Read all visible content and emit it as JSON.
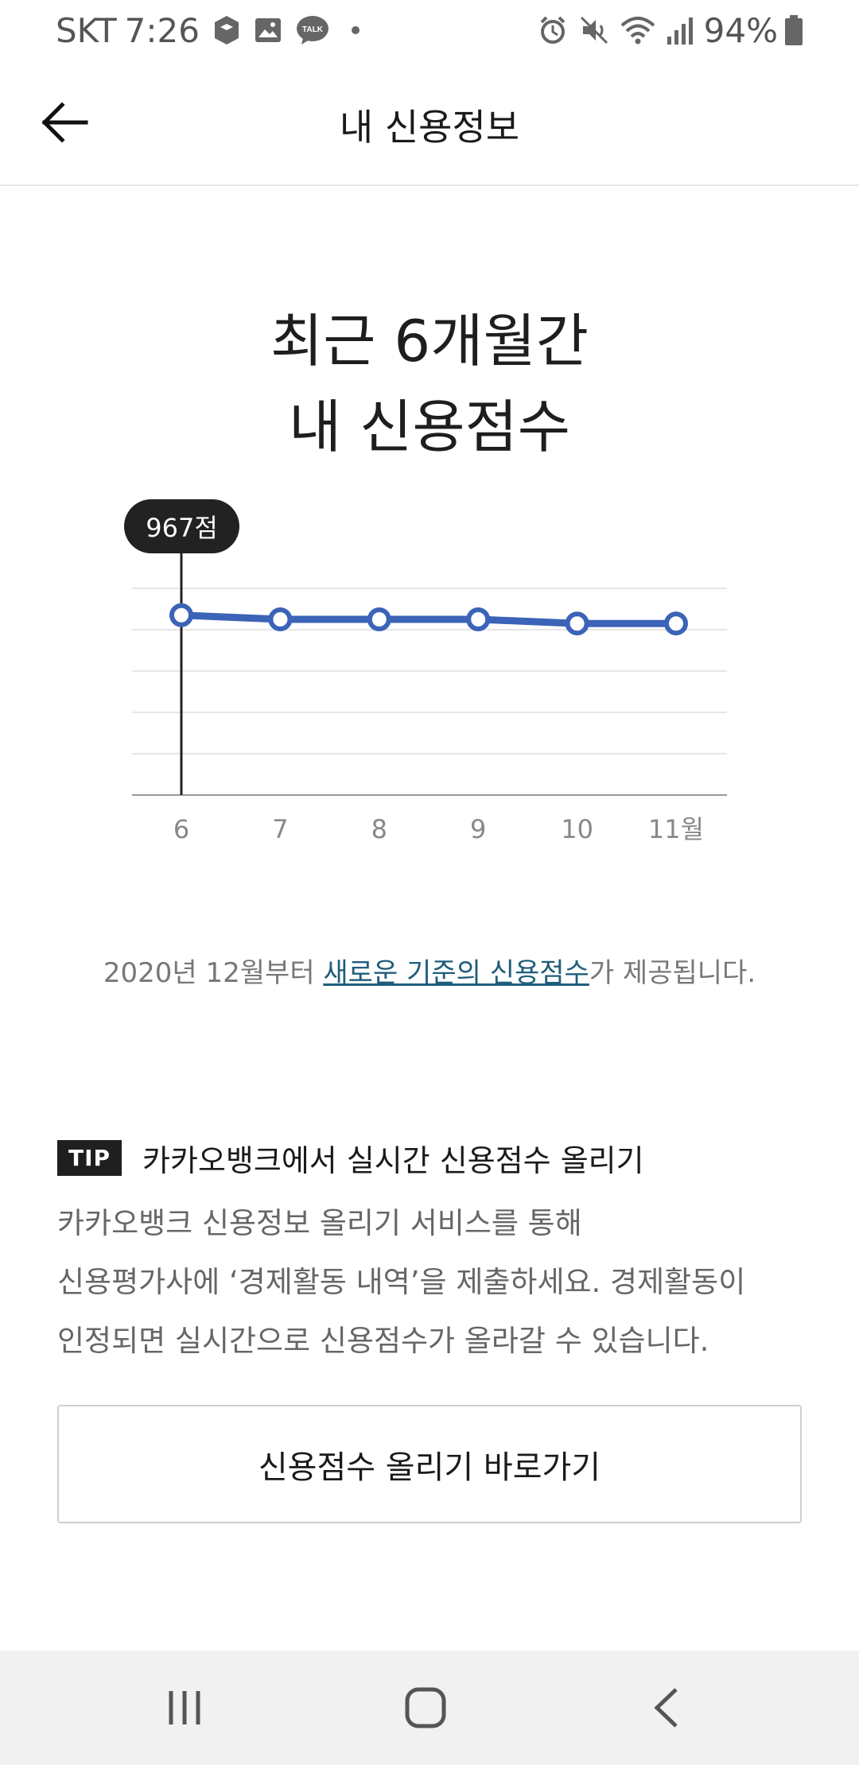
{
  "status_bar": {
    "carrier": "SKT",
    "time": "7:26",
    "battery_percent": "94%",
    "left_icons": [
      "shield-app-icon",
      "gallery-icon",
      "talk-icon",
      "dot-icon"
    ],
    "right_icons": [
      "alarm-icon",
      "mute-icon",
      "wifi-icon",
      "signal-icon",
      "battery-icon"
    ],
    "talk_icon_text": "TALK"
  },
  "app_bar": {
    "title": "내 신용정보",
    "back_icon": "arrow-left-icon"
  },
  "heading": {
    "line1": "최근 6개월간",
    "line2": "내 신용점수"
  },
  "chart_data": {
    "type": "line",
    "categories": [
      "6",
      "7",
      "8",
      "9",
      "10",
      "11월"
    ],
    "values": [
      967,
      965,
      965,
      965,
      963,
      963
    ],
    "ylim": [
      880,
      980
    ],
    "grid": true,
    "line_color": "#3b63b7",
    "selected_index": 0,
    "selected_label": "967점"
  },
  "notice": {
    "prefix": "2020년 12월부터 ",
    "link": "새로운 기준의 신용점수",
    "suffix": "가 제공됩니다."
  },
  "tip": {
    "badge": "TIP",
    "title": "카카오뱅크에서 실시간 신용점수 올리기",
    "lines": [
      "카카오뱅크 신용정보 올리기 서비스를 통해",
      "신용평가사에 ‘경제활동 내역’을 제출하세요. 경제활동이",
      "인정되면 실시간으로 신용점수가 올라갈 수 있습니다."
    ]
  },
  "cta": {
    "label": "신용점수 올리기 바로가기"
  },
  "nav_bar": {
    "icons": [
      "recent-apps-icon",
      "home-icon",
      "back-icon"
    ]
  }
}
